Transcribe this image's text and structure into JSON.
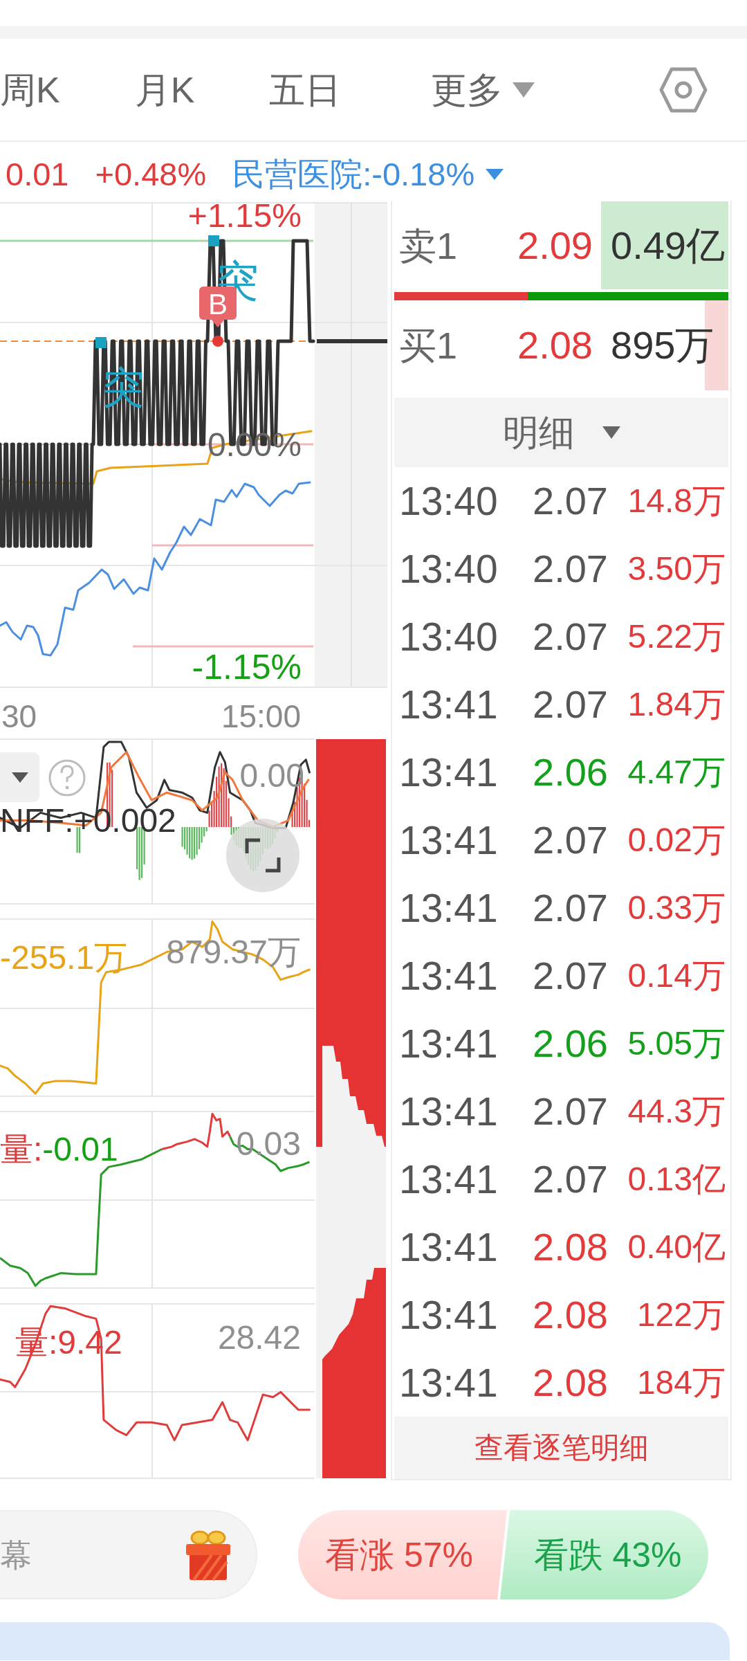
{
  "tabs": [
    {
      "label": "周K",
      "kind": "tab",
      "selected": false
    },
    {
      "label": "月K",
      "kind": "tab",
      "selected": false
    },
    {
      "label": "五日",
      "kind": "tab",
      "selected": false
    },
    {
      "label": "更多",
      "kind": "dropdown",
      "selected": false
    }
  ],
  "quote": [
    {
      "text": "0.01",
      "color": "#e33b3b"
    },
    {
      "text": "+0.48%",
      "color": "#e33b3b"
    }
  ],
  "sector": {
    "label": "民营医院:-0.18%"
  },
  "price_chart": {
    "upper_label": "+1.15%",
    "middle_label": "0.00%",
    "lower_label": "-1.15%",
    "signals": [
      {
        "label": "突"
      },
      {
        "label": "突"
      }
    ],
    "trade_marker": {
      "label": "B"
    },
    "time_labels": [
      "30",
      "15:00"
    ]
  },
  "indicators": [
    {
      "kind": "macd",
      "label": "NFF:+0.002",
      "color": "#333333",
      "max_label": "0.00"
    },
    {
      "kind": "line",
      "label": "-255.1万",
      "color": "#e8a317",
      "max_label": "879.37万"
    },
    {
      "kind": "split",
      "label": "量:",
      "color": "#e03c3c",
      "value": {
        "text": "-0.01",
        "color": "#16a016"
      },
      "max_label": "0.03"
    },
    {
      "kind": "line",
      "label": "量:9.42",
      "color": "#e03c3c",
      "max_label": "28.42"
    }
  ],
  "order_book": {
    "ask": {
      "label": "卖1",
      "price": {
        "text": "2.09",
        "color": "#e33b3b"
      },
      "volume": "0.49亿",
      "level": 0.38
    },
    "ratio": {
      "level": 0.4
    },
    "bid": {
      "label": "买1",
      "price": {
        "text": "2.08",
        "color": "#e33b3b"
      },
      "volume": "895万",
      "level": 0.07
    }
  },
  "trade_detail": {
    "title": "明细",
    "trades": [
      {
        "time": "13:40",
        "price": {
          "text": "2.07",
          "color": "#555555"
        },
        "volume": {
          "text": "14.8万",
          "color": "#e33b3b"
        }
      },
      {
        "time": "13:40",
        "price": {
          "text": "2.07",
          "color": "#555555"
        },
        "volume": {
          "text": "3.50万",
          "color": "#e33b3b"
        }
      },
      {
        "time": "13:40",
        "price": {
          "text": "2.07",
          "color": "#555555"
        },
        "volume": {
          "text": "5.22万",
          "color": "#e33b3b"
        }
      },
      {
        "time": "13:41",
        "price": {
          "text": "2.07",
          "color": "#555555"
        },
        "volume": {
          "text": "1.84万",
          "color": "#e33b3b"
        }
      },
      {
        "time": "13:41",
        "price": {
          "text": "2.06",
          "color": "#13a01b"
        },
        "volume": {
          "text": "4.47万",
          "color": "#13a01b"
        }
      },
      {
        "time": "13:41",
        "price": {
          "text": "2.07",
          "color": "#555555"
        },
        "volume": {
          "text": "0.02万",
          "color": "#e33b3b"
        }
      },
      {
        "time": "13:41",
        "price": {
          "text": "2.07",
          "color": "#555555"
        },
        "volume": {
          "text": "0.33万",
          "color": "#e33b3b"
        }
      },
      {
        "time": "13:41",
        "price": {
          "text": "2.07",
          "color": "#555555"
        },
        "volume": {
          "text": "0.14万",
          "color": "#e33b3b"
        }
      },
      {
        "time": "13:41",
        "price": {
          "text": "2.06",
          "color": "#13a01b"
        },
        "volume": {
          "text": "5.05万",
          "color": "#13a01b"
        }
      },
      {
        "time": "13:41",
        "price": {
          "text": "2.07",
          "color": "#555555"
        },
        "volume": {
          "text": "44.3万",
          "color": "#e33b3b"
        }
      },
      {
        "time": "13:41",
        "price": {
          "text": "2.07",
          "color": "#555555"
        },
        "volume": {
          "text": "0.13亿",
          "color": "#e33b3b"
        }
      },
      {
        "time": "13:41",
        "price": {
          "text": "2.08",
          "color": "#e33b3b"
        },
        "volume": {
          "text": "0.40亿",
          "color": "#e33b3b"
        }
      },
      {
        "time": "13:41",
        "price": {
          "text": "2.08",
          "color": "#e33b3b"
        },
        "volume": {
          "text": "122万",
          "color": "#e33b3b"
        }
      },
      {
        "time": "13:41",
        "price": {
          "text": "2.08",
          "color": "#e33b3b"
        },
        "volume": {
          "text": "184万",
          "color": "#e33b3b"
        }
      }
    ],
    "footer_button": "查看逐笔明细"
  },
  "comment_bar": {
    "placeholder": "幕"
  },
  "votes": [
    {
      "label": "看涨 57%",
      "kind": "up"
    },
    {
      "label": "看跌 43%",
      "kind": "down"
    }
  ]
}
